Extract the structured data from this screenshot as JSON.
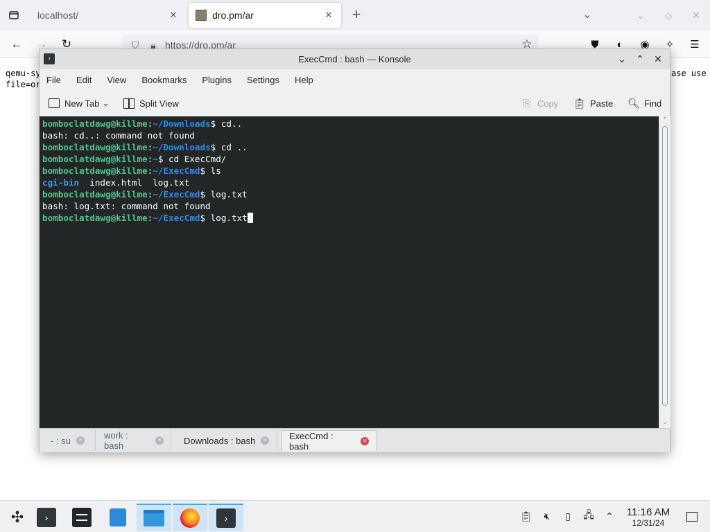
{
  "browser": {
    "tabs": [
      {
        "title": "localhost/"
      },
      {
        "title": "dro.pm/ar"
      }
    ],
    "url": "https://dro.pm/ar",
    "page_text_left": [
      "qemu-sy",
      "file=or"
    ],
    "page_text_right": [
      "ase use",
      ""
    ]
  },
  "konsole": {
    "title": "ExecCmd : bash — Konsole",
    "menu": [
      "File",
      "Edit",
      "View",
      "Bookmarks",
      "Plugins",
      "Settings",
      "Help"
    ],
    "toolbar": {
      "new_tab": "New Tab",
      "split_view": "Split View",
      "copy": "Copy",
      "paste": "Paste",
      "find": "Find"
    },
    "terminal_lines": [
      {
        "user": "bomboclatdawg@killme",
        "path": "~/Downloads",
        "cmd": " cd.."
      },
      {
        "output": "bash: cd..: command not found"
      },
      {
        "user": "bomboclatdawg@killme",
        "path": "~/Downloads",
        "cmd": " cd .."
      },
      {
        "user": "bomboclatdawg@killme",
        "path": "~",
        "cmd": " cd ExecCmd/"
      },
      {
        "user": "bomboclatdawg@killme",
        "path": "~/ExecCmd",
        "cmd": " ls"
      },
      {
        "listing": {
          "dir": "cgi-bin",
          "files": "  index.html  log.txt"
        }
      },
      {
        "user": "bomboclatdawg@killme",
        "path": "~/ExecCmd",
        "cmd": " log.txt"
      },
      {
        "output": "bash: log.txt: command not found"
      },
      {
        "user": "bomboclatdawg@killme",
        "path": "~/ExecCmd",
        "cmd": " log.txt",
        "cursor": true
      }
    ],
    "tabs": [
      {
        "label": "- : su"
      },
      {
        "label": "work : bash"
      },
      {
        "label": "Downloads : bash"
      },
      {
        "label": "ExecCmd : bash",
        "active": true
      }
    ]
  },
  "panel": {
    "time": "11:16 AM",
    "date": "12/31/24"
  }
}
